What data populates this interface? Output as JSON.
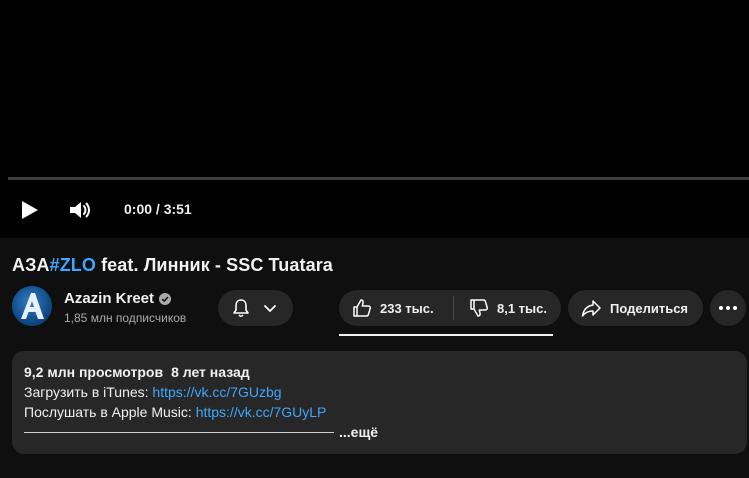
{
  "player": {
    "time": "0:00 / 3:51",
    "progress": 0
  },
  "video": {
    "title_prefix": "АЗА",
    "title_hashtag": "#ZLO",
    "title_rest": " feat. Линник - SSC Tuatara"
  },
  "channel": {
    "name": "Azazin Kreet",
    "subscribers": "1,85 млн подписчиков",
    "avatar_letter": "A"
  },
  "actions": {
    "likes": "233 тыс.",
    "dislikes": "8,1 тыс.",
    "share_label": "Поделиться"
  },
  "description": {
    "views": "9,2 млн просмотров",
    "date": "8 лет назад",
    "line1_label": "Загрузить в iTunes: ",
    "line1_link": "https://vk.cc/7GUzbg",
    "line2_label": "Послушать в Apple Music: ",
    "line2_link": "https://vk.cc/7GUyLP",
    "more": "...ещё"
  },
  "colors": {
    "background": "#0f0f0f",
    "pill": "#272727",
    "link": "#3ea6ff"
  },
  "icons": [
    "play-icon",
    "volume-icon",
    "verified-icon",
    "bell-icon",
    "chevron-down-icon",
    "like-icon",
    "dislike-icon",
    "share-icon",
    "more-icon"
  ]
}
